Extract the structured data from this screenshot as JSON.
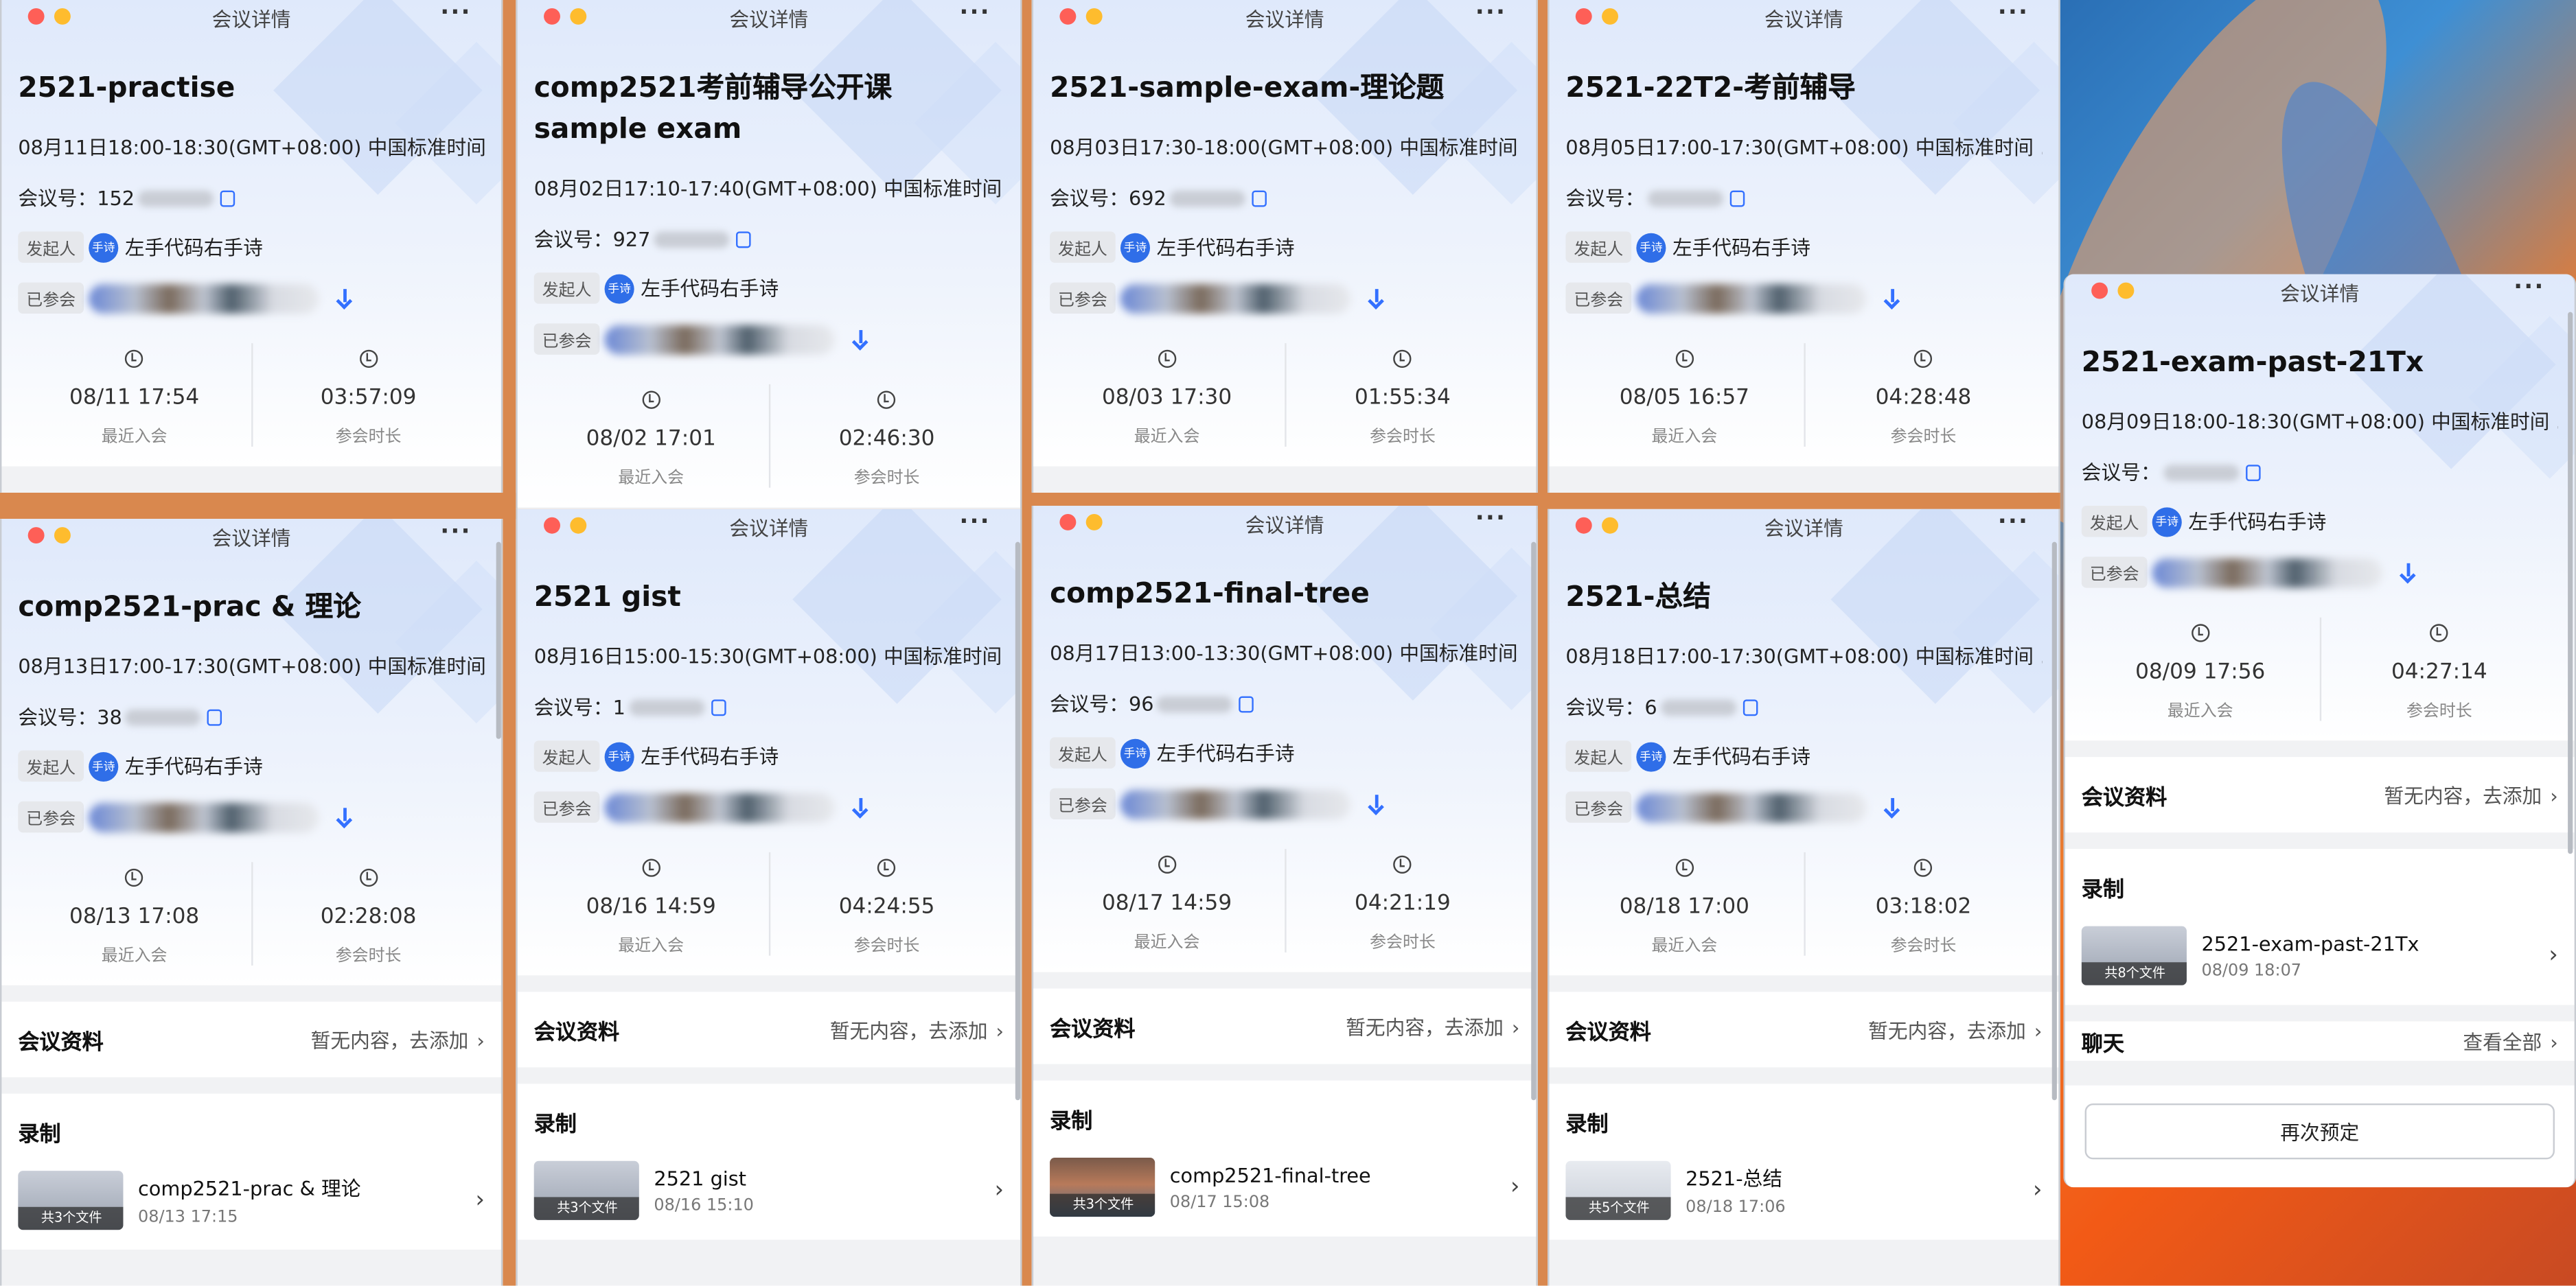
{
  "common": {
    "window_title": "会议详情",
    "more": "···",
    "meeting_id_label": "会议号：",
    "host_tag": "发起人",
    "host_avatar": "手诗",
    "host_name": "左手代码右手诗",
    "joined_tag": "已参会",
    "last_join_label": "最近入会",
    "duration_label": "参会时长",
    "materials_label": "会议资料",
    "materials_action": "暂无内容，去添加",
    "recording_label": "录制",
    "chat_label": "聊天",
    "chat_action": "查看全部",
    "rebook_label": "再次预定"
  },
  "windows": [
    {
      "title": "2521-practise",
      "time": "08月11日18:00-18:30(GMT+08:00) 中国标准时间 ...",
      "meeting_id": "152",
      "last_join": "08/11 17:54",
      "duration": "03:57:09"
    },
    {
      "title": "comp2521考前辅导公开课sample exam",
      "time": "08月02日17:10-17:40(GMT+08:00) 中国标准时间 ...",
      "meeting_id": "927",
      "last_join": "08/02 17:01",
      "duration": "02:46:30"
    },
    {
      "title": "2521-sample-exam-理论题",
      "time": "08月03日17:30-18:00(GMT+08:00) 中国标准时间 ...",
      "meeting_id": "692",
      "last_join": "08/03 17:30",
      "duration": "01:55:34"
    },
    {
      "title": "2521-22T2-考前辅导",
      "time": "08月05日17:00-17:30(GMT+08:00) 中国标准时间 ...",
      "meeting_id": "",
      "last_join": "08/05 16:57",
      "duration": "04:28:48"
    },
    {
      "title": "comp2521-prac & 理论",
      "time": "08月13日17:00-17:30(GMT+08:00) 中国标准时间 ...",
      "meeting_id": "38",
      "last_join": "08/13 17:08",
      "duration": "02:28:08",
      "recording": {
        "name": "comp2521-prac & 理论",
        "time": "08/13 17:15",
        "files": "共3个文件"
      }
    },
    {
      "title": "2521 gist",
      "time": "08月16日15:00-15:30(GMT+08:00) 中国标准时间 ...",
      "meeting_id": "1",
      "last_join": "08/16 14:59",
      "duration": "04:24:55",
      "recording": {
        "name": "2521 gist",
        "time": "08/16 15:10",
        "files": "共3个文件"
      }
    },
    {
      "title": "comp2521-final-tree",
      "time": "08月17日13:00-13:30(GMT+08:00) 中国标准时间 ...",
      "meeting_id": "96",
      "last_join": "08/17 14:59",
      "duration": "04:21:19",
      "recording": {
        "name": "comp2521-final-tree",
        "time": "08/17 15:08",
        "files": "共3个文件"
      }
    },
    {
      "title": "2521-总结",
      "time": "08月18日17:00-17:30(GMT+08:00) 中国标准时间 ...",
      "meeting_id": "6",
      "last_join": "08/18 17:00",
      "duration": "03:18:02",
      "recording": {
        "name": "2521-总结",
        "time": "08/18 17:06",
        "files": "共5个文件"
      }
    },
    {
      "title": "2521-exam-past-21Tx",
      "time": "08月09日18:00-18:30(GMT+08:00) 中国标准时间 ...",
      "meeting_id": "",
      "last_join": "08/09 17:56",
      "duration": "04:27:14",
      "recording": {
        "name": "2521-exam-past-21Tx",
        "time": "08/09 18:07",
        "files": "共8个文件"
      }
    }
  ]
}
